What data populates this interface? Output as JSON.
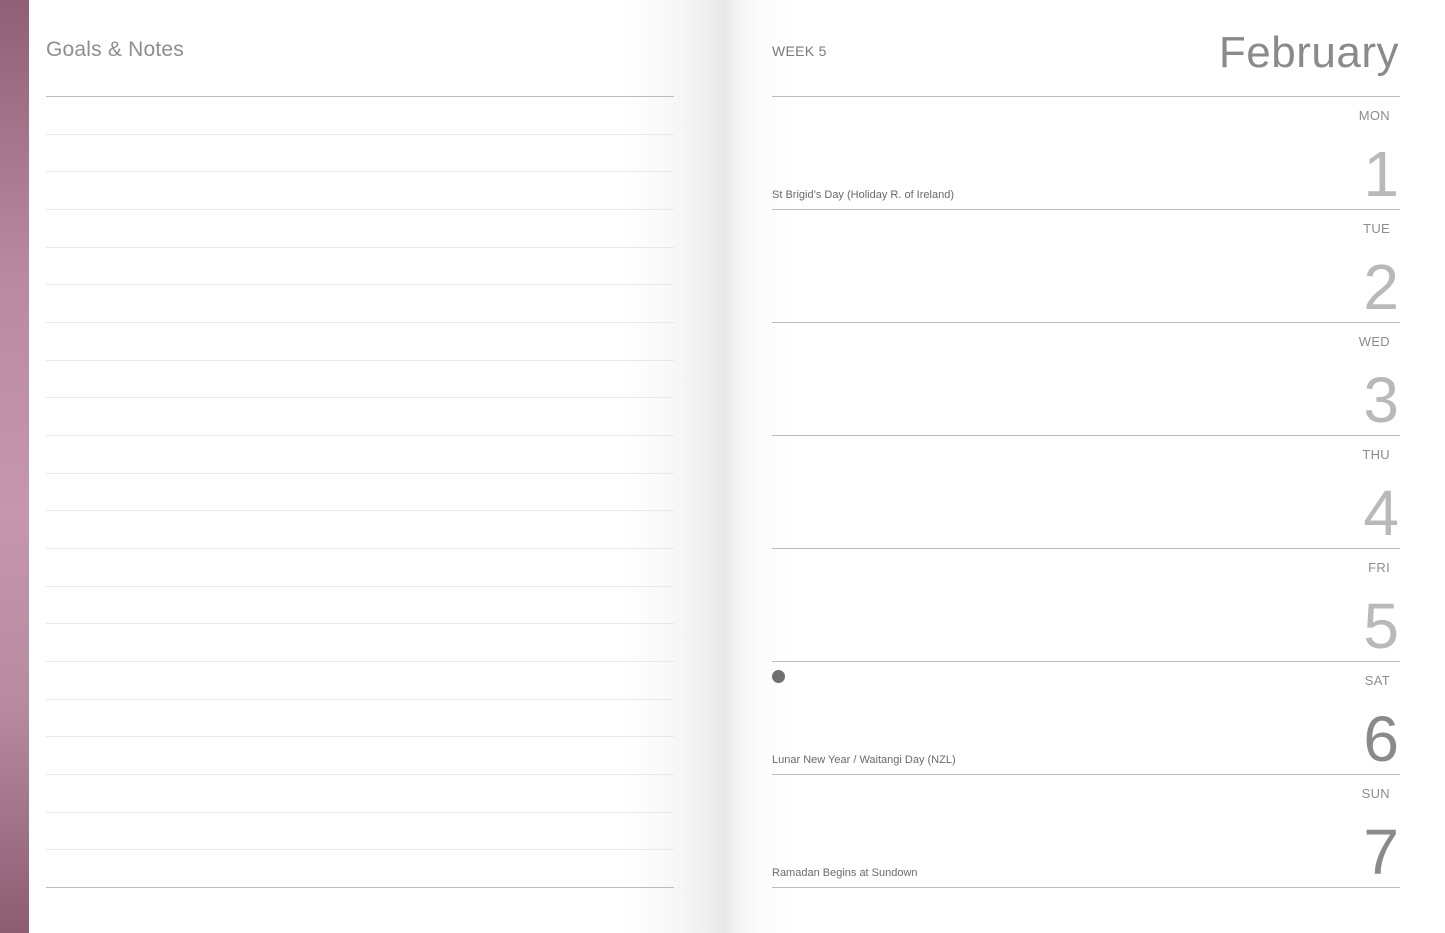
{
  "left_page": {
    "title": "Goals & Notes",
    "line_count": 22
  },
  "right_page": {
    "week_label": "WEEK 5",
    "month": "February",
    "days": [
      {
        "name": "MON",
        "number": "1",
        "event": "St Brigid’s Day (Holiday R. of Ireland)"
      },
      {
        "name": "TUE",
        "number": "2",
        "event": ""
      },
      {
        "name": "WED",
        "number": "3",
        "event": ""
      },
      {
        "name": "THU",
        "number": "4",
        "event": ""
      },
      {
        "name": "FRI",
        "number": "5",
        "event": ""
      },
      {
        "name": "SAT",
        "number": "6",
        "event": "Lunar New Year / Waitangi Day (NZL)",
        "moon_phase": "new-moon"
      },
      {
        "name": "SUN",
        "number": "7",
        "event": "Ramadan Begins at Sundown"
      }
    ]
  },
  "colors": {
    "cover_edge": "#b98aa2",
    "rule": "#bcbcbc",
    "text_muted": "#8a8a8a"
  }
}
